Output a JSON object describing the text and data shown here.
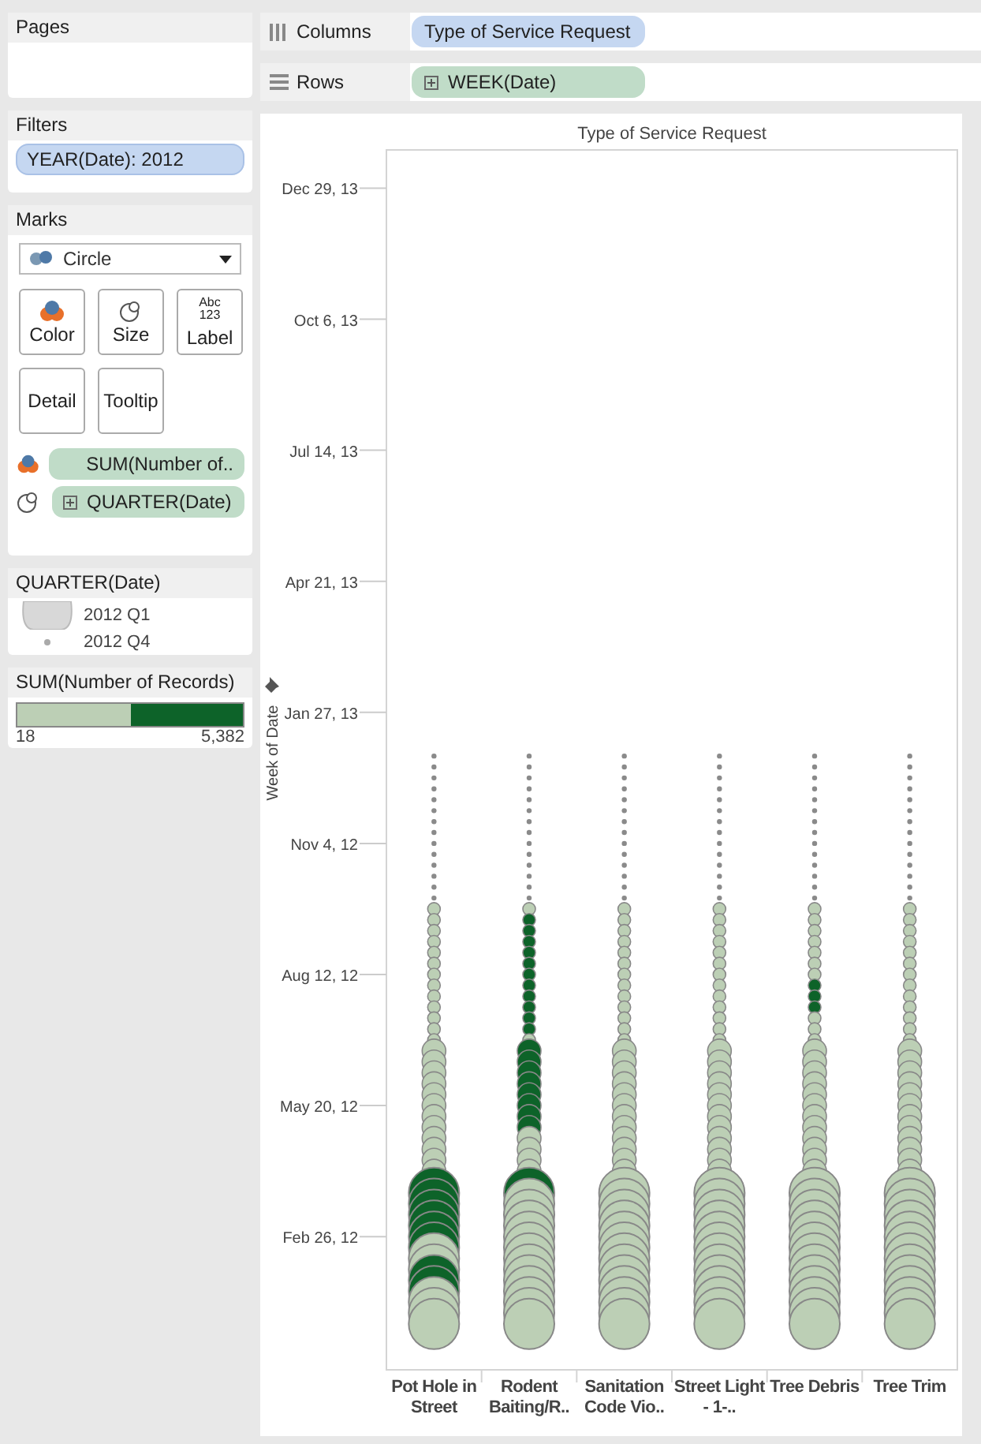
{
  "pages_card": {
    "title": "Pages"
  },
  "filters_card": {
    "title": "Filters",
    "pills": [
      "YEAR(Date): 2012"
    ]
  },
  "marks_card": {
    "title": "Marks",
    "mark_type": "Circle",
    "buttons": [
      {
        "kind": "color",
        "label": "Color"
      },
      {
        "kind": "size",
        "label": "Size"
      },
      {
        "kind": "label",
        "label": "Label",
        "glyph_lines": [
          "Abc",
          "123"
        ]
      },
      {
        "kind": "detail",
        "label": "Detail"
      },
      {
        "kind": "tooltip",
        "label": "Tooltip"
      }
    ],
    "fields": [
      {
        "kind": "color",
        "label": "SUM(Number of..",
        "expandable": false
      },
      {
        "kind": "size",
        "label": "QUARTER(Date)",
        "expandable": true
      }
    ]
  },
  "size_legend": {
    "title": "QUARTER(Date)",
    "items": [
      {
        "label": "2012 Q1",
        "kind": "large"
      },
      {
        "label": "2012 Q4",
        "kind": "small"
      }
    ]
  },
  "color_legend": {
    "title": "SUM(Number of Records)",
    "min_label": "18",
    "max_label": "5,382",
    "level": 0.5
  },
  "columns_shelf": {
    "label": "Columns",
    "pills": [
      {
        "label": "Type of Service Request",
        "expandable": false
      }
    ]
  },
  "rows_shelf": {
    "label": "Rows",
    "pills": [
      {
        "label": "WEEK(Date)",
        "expandable": true
      }
    ]
  },
  "chart": {
    "title": "Type of Service Request",
    "axis_title": "Week of Date",
    "tick_labels": [
      "Dec 29, 13",
      "Oct 6, 13",
      "Jul 14, 13",
      "Apr 21, 13",
      "Jan 27, 13",
      "Nov 4, 12",
      "Aug 12, 12",
      "May 20, 12",
      "Feb 26, 12"
    ],
    "column_labels": [
      "Pot Hole in Street",
      "Rodent Baiting/R..",
      "Sanitation Code Vio..",
      "Street Light - 1-..",
      "Tree Debris",
      "Tree Trim"
    ]
  }
}
